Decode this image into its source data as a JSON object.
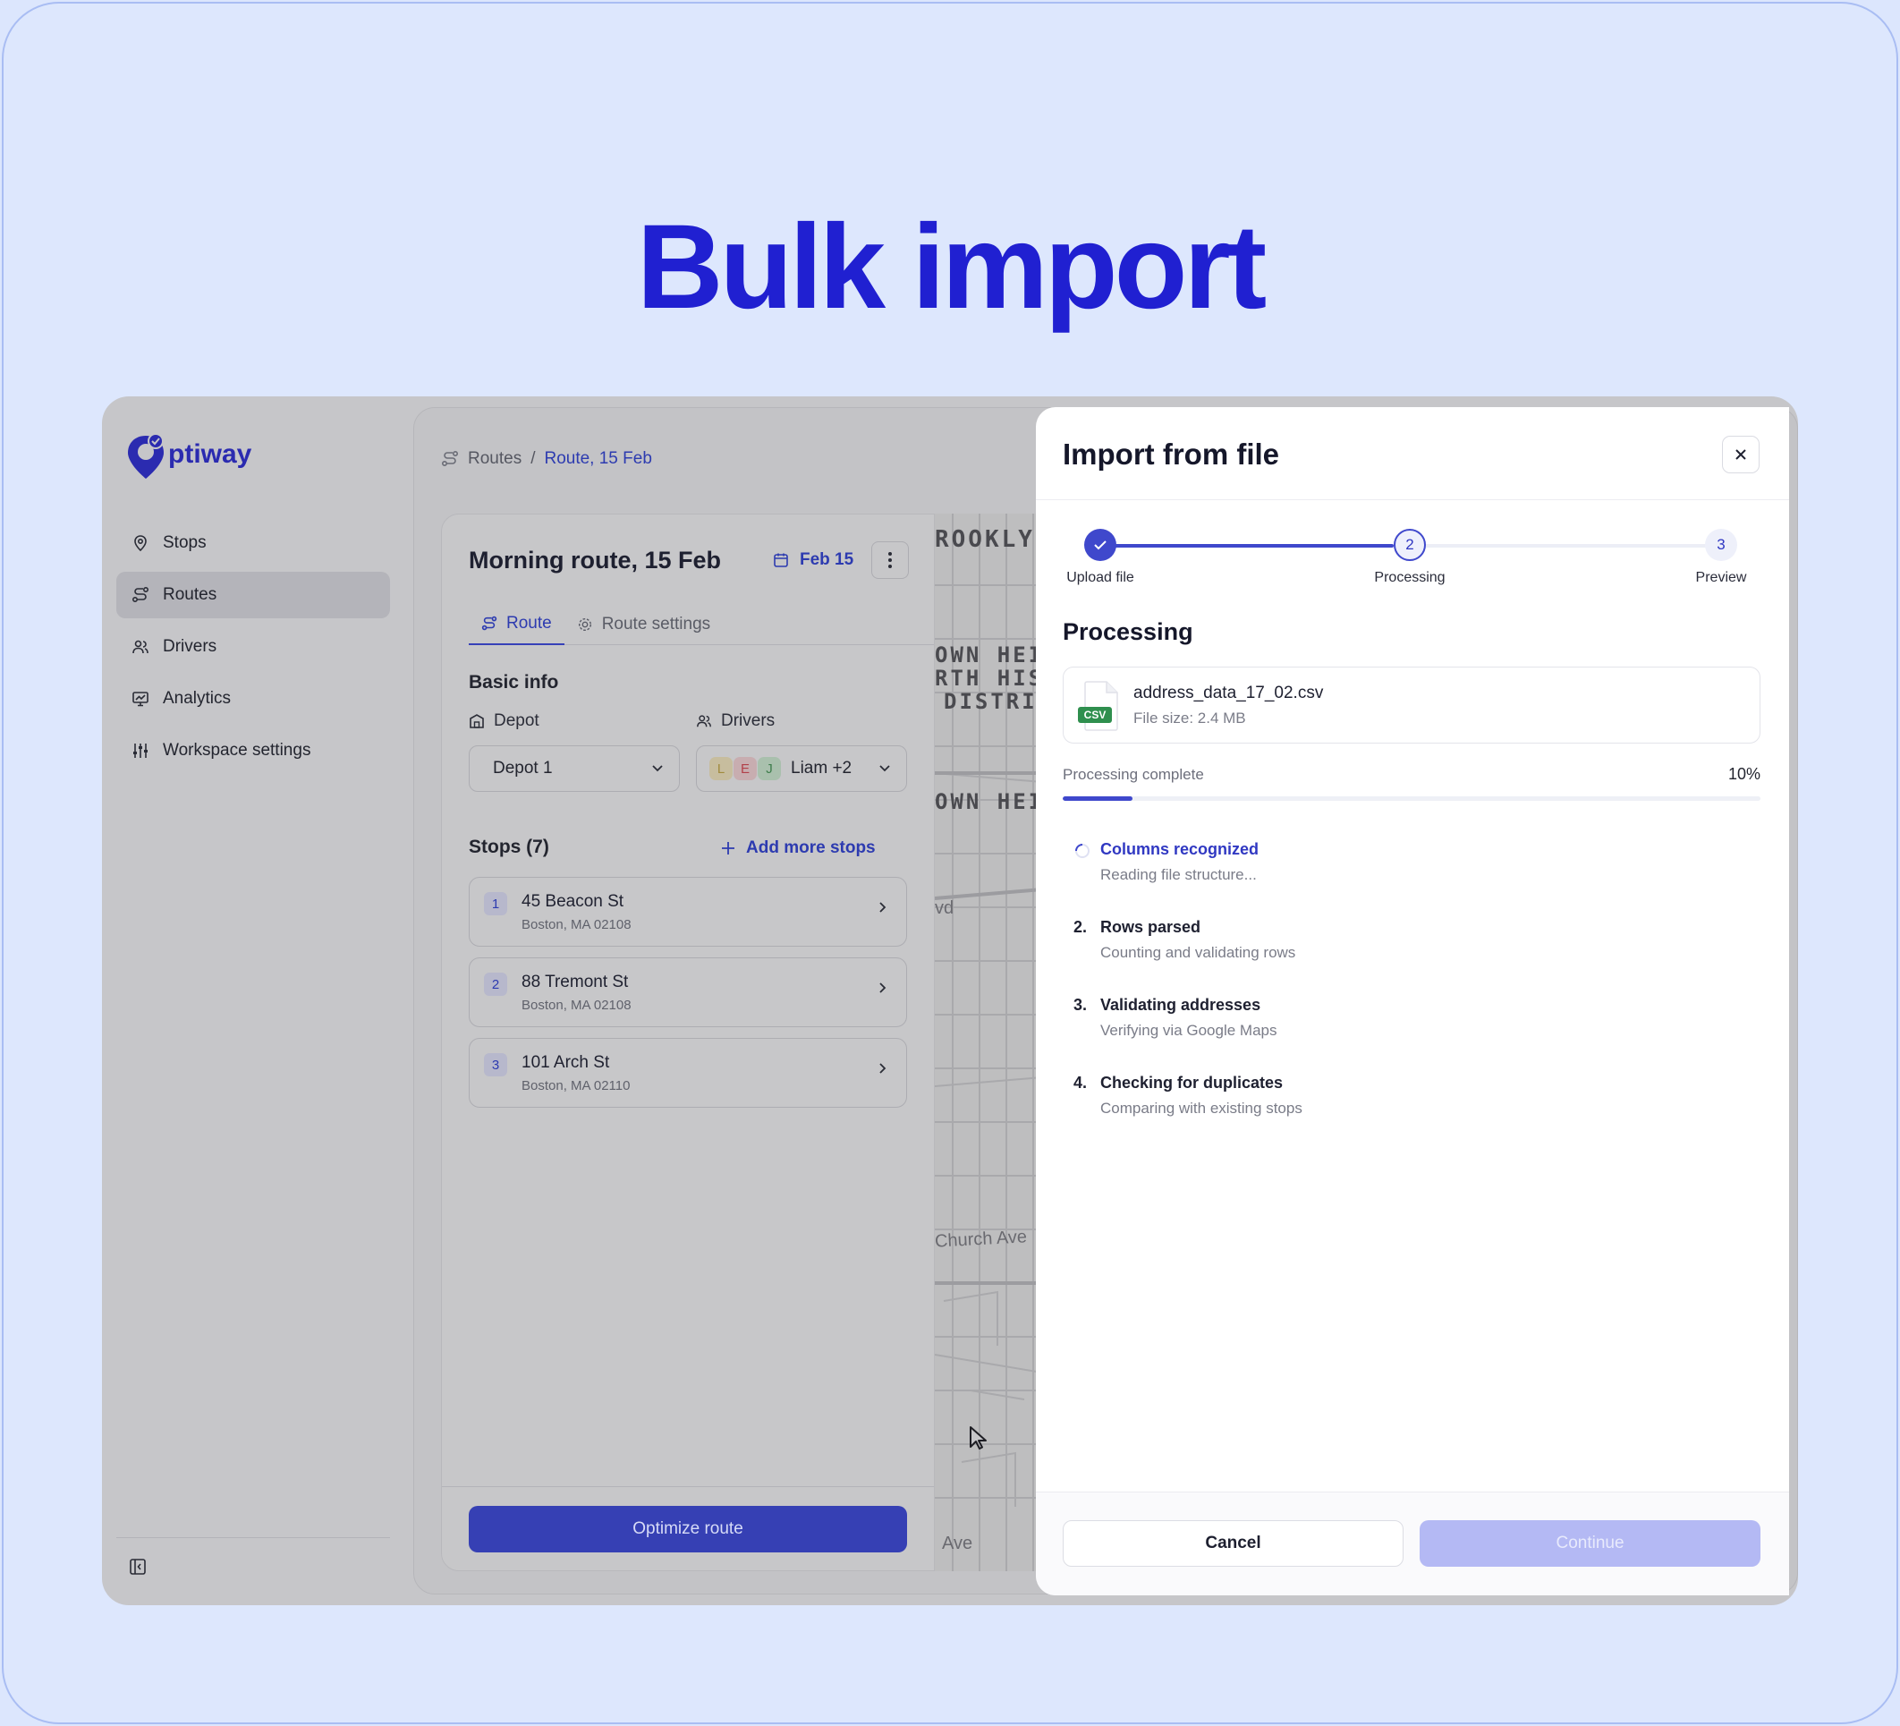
{
  "hero": {
    "title": "Bulk import"
  },
  "app": {
    "logo_text": "ptiway",
    "brand_color": "#2b2bb0"
  },
  "sidebar": {
    "items": [
      {
        "label": "Stops",
        "icon": "map-pin-icon"
      },
      {
        "label": "Routes",
        "icon": "route-icon",
        "active": true
      },
      {
        "label": "Drivers",
        "icon": "users-icon"
      },
      {
        "label": "Analytics",
        "icon": "chart-icon"
      },
      {
        "label": "Workspace settings",
        "icon": "sliders-icon"
      }
    ]
  },
  "breadcrumb": {
    "root": "Routes",
    "separator": "/",
    "current": "Route, 15 Feb"
  },
  "route_panel": {
    "title": "Morning route, 15 Feb",
    "date": "Feb 15",
    "tabs": [
      {
        "label": "Route",
        "active": true
      },
      {
        "label": "Route settings"
      }
    ],
    "basic_info_heading": "Basic info",
    "depot_label": "Depot",
    "depot_value": "Depot 1",
    "drivers_label": "Drivers",
    "drivers_avatars": [
      "L",
      "E",
      "J"
    ],
    "drivers_value": "Liam +2",
    "stops_heading": "Stops (7)",
    "add_stops_label": "Add more stops",
    "stops": [
      {
        "num": "1",
        "address": "45 Beacon St",
        "city": "Boston, MA 02108"
      },
      {
        "num": "2",
        "address": "88 Tremont St",
        "city": "Boston, MA 02108"
      },
      {
        "num": "3",
        "address": "101 Arch St",
        "city": "Boston, MA 02110"
      }
    ],
    "optimize_label": "Optimize route"
  },
  "map": {
    "labels": [
      "ROOKLY",
      "OWN HEIG",
      "RTH HIST",
      "DISTRIC",
      "OWN HEIG"
    ],
    "streets": [
      "vd",
      "Church Ave",
      "Ave"
    ]
  },
  "modal": {
    "title": "Import from file",
    "steps": [
      {
        "num": "1",
        "label": "Upload file",
        "state": "done"
      },
      {
        "num": "2",
        "label": "Processing",
        "state": "current"
      },
      {
        "num": "3",
        "label": "Preview",
        "state": "upcoming"
      }
    ],
    "section_title": "Processing",
    "file": {
      "badge": "CSV",
      "name": "address_data_17_02.csv",
      "size": "File size: 2.4 MB"
    },
    "progress": {
      "label": "Processing complete",
      "value_text": "10%",
      "fraction": 0.1
    },
    "tasks": [
      {
        "marker": "",
        "title": "Columns recognized",
        "subtitle": "Reading file structure...",
        "state": "in-progress"
      },
      {
        "marker": "2.",
        "title": "Rows parsed",
        "subtitle": "Counting and validating rows",
        "state": "pending"
      },
      {
        "marker": "3.",
        "title": "Validating addresses",
        "subtitle": "Verifying via Google Maps",
        "state": "pending"
      },
      {
        "marker": "4.",
        "title": "Checking for duplicates",
        "subtitle": "Comparing with existing stops",
        "state": "pending"
      }
    ],
    "cancel_label": "Cancel",
    "continue_label": "Continue"
  },
  "colors": {
    "accent": "#3f48cc",
    "hero": "#2020d1",
    "background": "#dce6fd",
    "continue_disabled": "#b4b9f4"
  }
}
